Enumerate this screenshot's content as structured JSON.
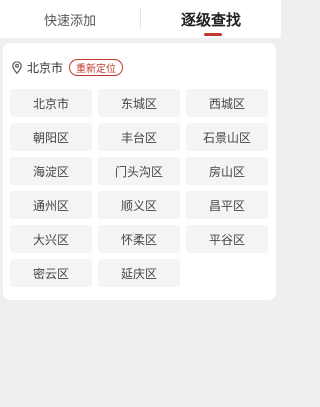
{
  "tabs": {
    "quick_add": "快速添加",
    "level_search": "逐级查找"
  },
  "location": {
    "city": "北京市",
    "relocate_label": "重新定位"
  },
  "districts": [
    "北京市",
    "东城区",
    "西城区",
    "朝阳区",
    "丰台区",
    "石景山区",
    "海淀区",
    "门头沟区",
    "房山区",
    "通州区",
    "顺义区",
    "昌平区",
    "大兴区",
    "怀柔区",
    "平谷区",
    "密云区",
    "延庆区"
  ],
  "colors": {
    "accent": "#c0392b",
    "background": "#efefef",
    "cell_bg": "#f4f4f4"
  },
  "icons": {
    "location": "location-pin-icon"
  }
}
